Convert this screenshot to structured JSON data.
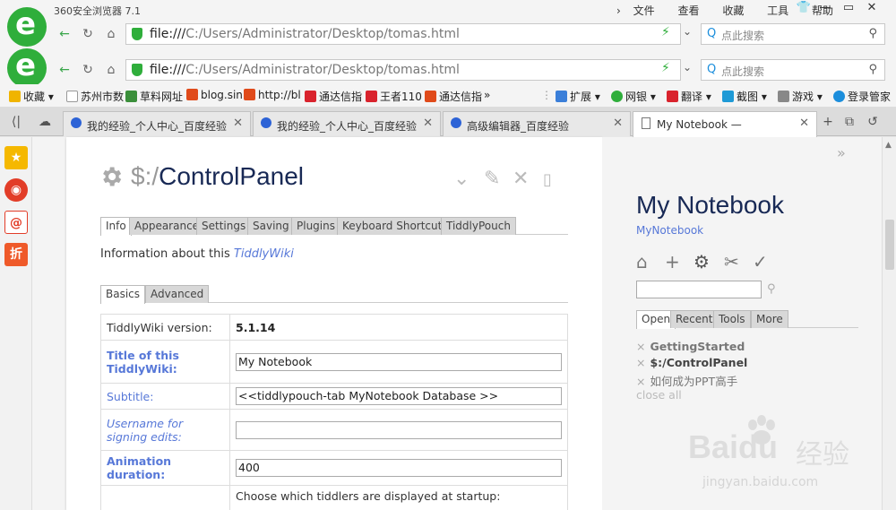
{
  "browser": {
    "app_title": "360安全浏览器 7.1",
    "menu": [
      "文件",
      "查看",
      "收藏",
      "工具",
      "帮助"
    ],
    "url_prefix": "file:///",
    "url_path": "C:/Users/Administrator/Desktop/tomas.html",
    "search_placeholder": "点此搜索",
    "accent": "#2fae3b"
  },
  "bookmarks": {
    "favorites": "收藏",
    "items": [
      "苏州市数",
      "草料网址",
      "blog.sin",
      "http://bl",
      "通达信指",
      "王者110",
      "通达信指"
    ],
    "more": "»",
    "right": [
      "扩展",
      "网银",
      "翻译",
      "截图",
      "游戏",
      "登录管家"
    ]
  },
  "tabs": [
    {
      "label": "我的经验_个人中心_百度经验",
      "active": false
    },
    {
      "label": "我的经验_个人中心_百度经验",
      "active": false
    },
    {
      "label": "高级编辑器_百度经验",
      "active": false
    },
    {
      "label": "My Notebook —",
      "active": true
    }
  ],
  "tiddler": {
    "title_prefix": "$:/",
    "title": "ControlPanel",
    "tabs": [
      "Info",
      "Appearance",
      "Settings",
      "Saving",
      "Plugins",
      "Keyboard Shortcuts",
      "TiddlyPouch"
    ],
    "info_text": "Information about this ",
    "info_link": "TiddlyWiki",
    "subtabs": [
      "Basics",
      "Advanced"
    ],
    "rows": {
      "version_label": "TiddlyWiki version:",
      "version_value": "5.1.14",
      "title_label": "Title of this TiddlyWiki:",
      "title_value": "My Notebook",
      "subtitle_label": "Subtitle:",
      "subtitle_value": "<<tiddlypouch-tab MyNotebook Database >>",
      "username_label": "Username for signing edits:",
      "username_value": "",
      "anim_label": "Animation duration:",
      "anim_value": "400",
      "startup_text": "Choose which tiddlers are displayed at startup:"
    }
  },
  "sidebar": {
    "site_title": "My Notebook",
    "site_subtitle": "MyNotebook",
    "search_value": "",
    "tabs": [
      "Open",
      "Recent",
      "Tools",
      "More"
    ],
    "open_list": [
      "GettingStarted",
      "$:/ControlPanel",
      "如何成为PPT高手"
    ],
    "close_all": "close all"
  },
  "watermark": {
    "brand": "Bai",
    "brand2": "du",
    "cn": "经验",
    "url": "jingyan.baidu.com"
  }
}
